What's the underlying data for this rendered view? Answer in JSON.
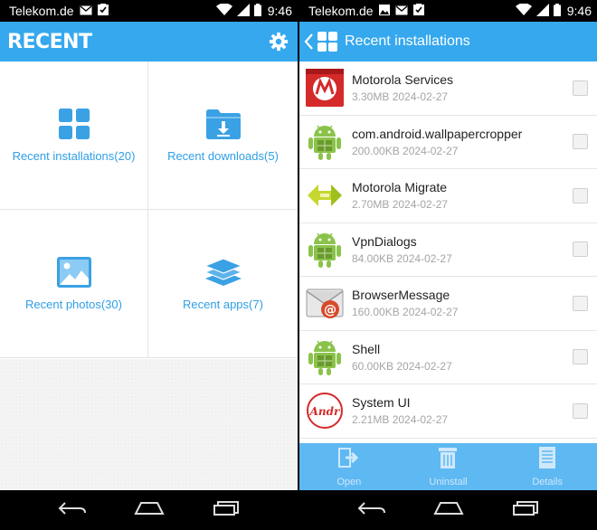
{
  "status_left": {
    "carrier": "Telekom.de",
    "time": "9:46"
  },
  "status_right": {
    "carrier": "Telekom.de",
    "time": "9:46"
  },
  "left_screen": {
    "title": "RECENT",
    "tiles": [
      {
        "label": "Recent installations(20)",
        "icon": "grid-icon"
      },
      {
        "label": "Recent downloads(5)",
        "icon": "download-folder-icon"
      },
      {
        "label": "Recent photos(30)",
        "icon": "photo-icon"
      },
      {
        "label": "Recent apps(7)",
        "icon": "layers-icon"
      }
    ]
  },
  "right_screen": {
    "title": "Recent installations",
    "items": [
      {
        "name": "Motorola Services",
        "meta": "3.30MB 2024-02-27",
        "icon": "motorola-icon"
      },
      {
        "name": "com.android.wallpapercropper",
        "meta": "200.00KB 2024-02-27",
        "icon": "android-robot-icon"
      },
      {
        "name": "Motorola Migrate",
        "meta": "2.70MB 2024-02-27",
        "icon": "migrate-icon"
      },
      {
        "name": "VpnDialogs",
        "meta": "84.00KB 2024-02-27",
        "icon": "android-robot-icon"
      },
      {
        "name": "BrowserMessage",
        "meta": "160.00KB 2024-02-27",
        "icon": "email-icon"
      },
      {
        "name": "Shell",
        "meta": "60.00KB 2024-02-27",
        "icon": "android-robot-icon"
      },
      {
        "name": "System UI",
        "meta": "2.21MB 2024-02-27",
        "icon": "android-logo-icon"
      }
    ],
    "actions": [
      {
        "label": "Open",
        "icon": "open-icon"
      },
      {
        "label": "Uninstall",
        "icon": "trash-icon"
      },
      {
        "label": "Details",
        "icon": "details-icon"
      }
    ]
  },
  "colors": {
    "accent": "#35a8ee",
    "action_bar": "#5eb8f2",
    "label_blue": "#2f9fe6"
  }
}
